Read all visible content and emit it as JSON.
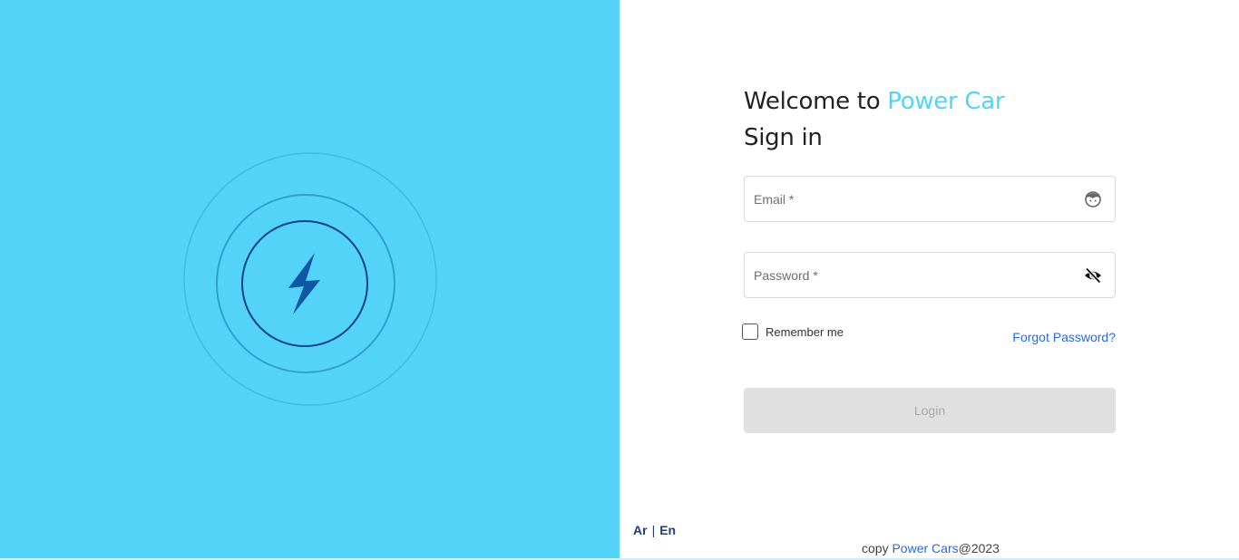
{
  "brand_panel": {
    "logo_icon": "lightning-bolt-icon",
    "background_color": "#54d3f9",
    "bolt_color": "#0d57a5"
  },
  "login": {
    "welcome_prefix": "Welcome to",
    "brand_name": "Power Car",
    "subtitle": "Sign in",
    "email_placeholder": "Email *",
    "email_icon": "face-icon",
    "password_placeholder": "Password *",
    "password_icon": "eye-off-icon",
    "remember_label": "Remember me",
    "forgot_label": "Forgot Password?",
    "login_label": "Login"
  },
  "footer": {
    "lang_ar": "Ar",
    "lang_separator": "|",
    "lang_en": "En",
    "copy_prefix": "copy",
    "copy_brand": "Power Cars",
    "copy_suffix": "@2023"
  },
  "colors": {
    "accent": "#54d3f9",
    "link": "#2a6ad8",
    "heading": "#222222",
    "button_disabled": "#e0e0e0"
  }
}
